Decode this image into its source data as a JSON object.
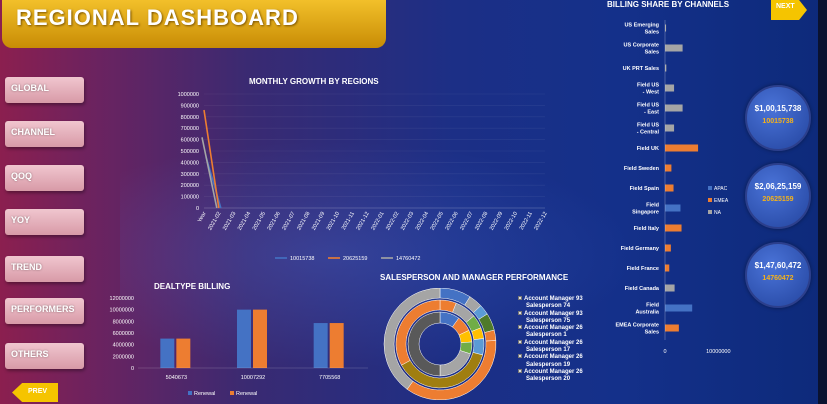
{
  "title": "REGIONAL DASHBOARD",
  "nav": {
    "items": [
      "GLOBAL",
      "CHANNEL",
      "QOQ",
      "YOY",
      "TREND",
      "PERFORMERS",
      "OTHERS"
    ],
    "prev": "PREV",
    "next": "NEXT"
  },
  "colors": {
    "blue": "#4472c4",
    "orange": "#ed7d31",
    "gray": "#a5a5a5",
    "gold": "#f5c400",
    "kpi_value": "#f5b21a"
  },
  "monthly_growth": {
    "title": "MONTHLY GROWTH BY REGIONS",
    "legend": [
      "10015738",
      "20625159",
      "14760472"
    ]
  },
  "billing_share": {
    "title": "BILLING SHARE BY CHANNELS",
    "legend": [
      "APAC",
      "EMEA",
      "NA"
    ],
    "x_tick_0": "0",
    "x_tick_1": "10000000"
  },
  "dealtype": {
    "title": "DEALTYPE BILLING",
    "legend": [
      "Renewal",
      "Renewal"
    ]
  },
  "salesperson": {
    "title": "SALESPERSON AND MANAGER PERFORMANCE",
    "legend": [
      "Account Manager 93",
      "Salesperson 74",
      "Account Manager 93",
      "Salesperson 75",
      "Account Manager 26",
      "Salesperson 1",
      "Account Manager 26",
      "Salesperson 17",
      "Account Manager 26",
      "Salesperson 19",
      "Account Manager 26",
      "Salesperson 20"
    ]
  },
  "kpis": [
    {
      "big": "$1,00,15,738",
      "small": "10015738"
    },
    {
      "big": "$2,06,25,159",
      "small": "20625159"
    },
    {
      "big": "$1,47,60,472",
      "small": "14760472"
    }
  ],
  "chart_data": [
    {
      "type": "line",
      "title": "MONTHLY GROWTH BY REGIONS",
      "categories": [
        "Year",
        "2021-02",
        "2021-03",
        "2021-04",
        "2021-05",
        "2021-06",
        "2021-07",
        "2021-08",
        "2021-09",
        "2021-10",
        "2021-11",
        "2021-12",
        "2022-01",
        "2022-02",
        "2022-03",
        "2022-04",
        "2022-05",
        "2022-06",
        "2022-07",
        "2022-08",
        "2022-09",
        "2022-10",
        "2022-11",
        "2022-12"
      ],
      "y_ticks": [
        "1000000",
        "900000",
        "800000",
        "700000",
        "600000",
        "500000",
        "400000",
        "300000",
        "200000",
        "100000",
        "0"
      ],
      "ylim": [
        0,
        1000000
      ],
      "series": [
        {
          "name": "10015738",
          "color": "#4472c4",
          "values": [
            450000,
            0
          ]
        },
        {
          "name": "20625159",
          "color": "#ed7d31",
          "values": [
            860000,
            0
          ]
        },
        {
          "name": "14760472",
          "color": "#a5a5a5",
          "values": [
            620000,
            0
          ]
        }
      ]
    },
    {
      "type": "bar",
      "title": "BILLING SHARE BY CHANNELS",
      "orientation": "horizontal",
      "xlim": [
        0,
        15000000
      ],
      "categories": [
        "US Emerging Sales",
        "US Corporate Sales",
        "UK PRT Sales",
        "Field US - West",
        "Field US - East",
        "Field US - Central",
        "Field UK",
        "Field Sweden",
        "Field Spain",
        "Field Singapore",
        "Field Italy",
        "Field Germany",
        "Field France",
        "Field Canada",
        "Field Australia",
        "EMEA Corporate Sales"
      ],
      "values": [
        200000,
        3300000,
        250000,
        1700000,
        3300000,
        1700000,
        6200000,
        1200000,
        1600000,
        2900000,
        3100000,
        1100000,
        800000,
        1800000,
        5100000,
        2600000
      ],
      "bar_colors": [
        "#a5a5a5",
        "#a5a5a5",
        "#a5a5a5",
        "#a5a5a5",
        "#a5a5a5",
        "#a5a5a5",
        "#ed7d31",
        "#ed7d31",
        "#ed7d31",
        "#4472c4",
        "#ed7d31",
        "#ed7d31",
        "#ed7d31",
        "#a5a5a5",
        "#4472c4",
        "#ed7d31"
      ]
    },
    {
      "type": "bar",
      "title": "DEALTYPE BILLING",
      "categories": [
        "5040673",
        "10007292",
        "7705568"
      ],
      "y_ticks": [
        "12000000",
        "10000000",
        "8000000",
        "6000000",
        "4000000",
        "2000000",
        "0"
      ],
      "ylim": [
        0,
        12000000
      ],
      "series": [
        {
          "name": "Renewal",
          "color": "#4472c4",
          "values": [
            5040673,
            10007292,
            7705568
          ]
        },
        {
          "name": "Renewal",
          "color": "#ed7d31",
          "values": [
            5040673,
            10007292,
            7705568
          ]
        }
      ]
    },
    {
      "type": "pie",
      "title": "SALESPERSON AND MANAGER PERFORMANCE",
      "rings": [
        {
          "values": [
            9,
            4,
            3,
            5,
            3,
            36,
            40
          ],
          "colors": [
            "#4472c4",
            "#a5a5a5",
            "#5b9bd5",
            "#4f7a2a",
            "#ed7d31",
            "#ed7d31",
            "#a5a5a5"
          ]
        },
        {
          "values": [
            6,
            8,
            5,
            4,
            6,
            38,
            33
          ],
          "colors": [
            "#ed7d31",
            "#a5a5a5",
            "#70ad47",
            "#ffc000",
            "#5b9bd5",
            "#a07e10",
            "#ed7d31"
          ]
        },
        {
          "values": [
            10,
            8,
            6,
            6,
            20,
            50
          ],
          "colors": [
            "#4472c4",
            "#ed7d31",
            "#ffc000",
            "#70ad47",
            "#a5a5a5",
            "#595959"
          ]
        }
      ]
    }
  ]
}
